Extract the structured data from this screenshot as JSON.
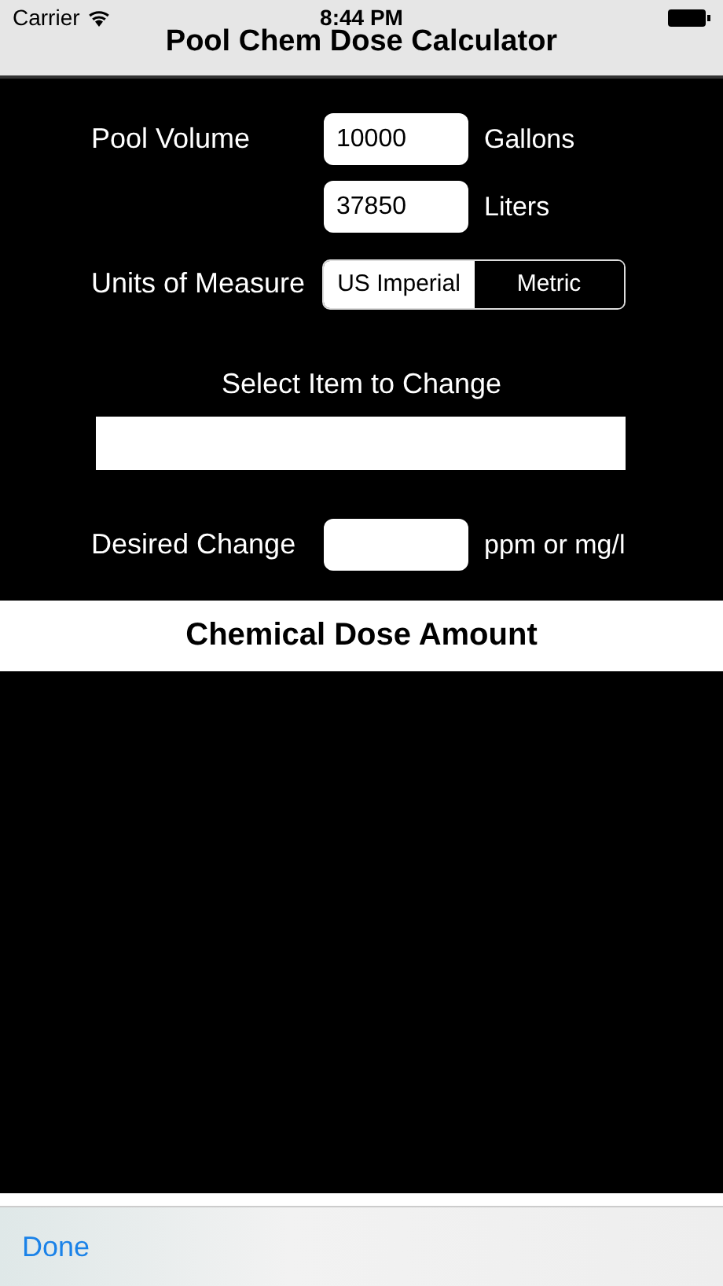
{
  "status_bar": {
    "carrier": "Carrier",
    "time": "8:44 PM"
  },
  "nav_bar": {
    "title": "Pool Chem Dose Calculator"
  },
  "pool_volume": {
    "label": "Pool Volume",
    "fields": [
      {
        "value": "10000",
        "unit": "Gallons"
      },
      {
        "value": "37850",
        "unit": "Liters"
      }
    ]
  },
  "units_of_measure": {
    "label": "Units of Measure",
    "segments": [
      {
        "label": "US Imperial",
        "selected": true
      },
      {
        "label": "Metric",
        "selected": false
      }
    ]
  },
  "select_item": {
    "label": "Select Item to Change"
  },
  "desired_change": {
    "label": "Desired Change",
    "unit": "ppm or mg/l"
  },
  "result_header": "Chemical Dose Amount",
  "toolbar": {
    "done": "Done"
  }
}
